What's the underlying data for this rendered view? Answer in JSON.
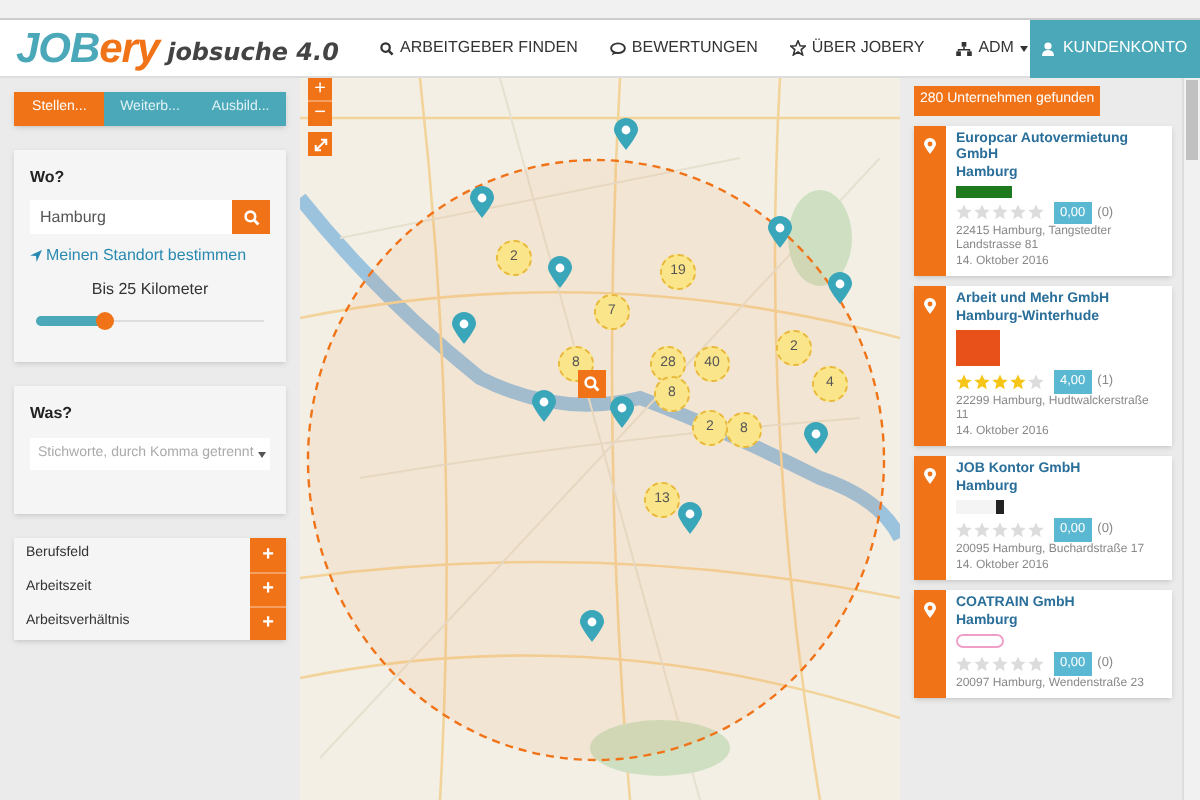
{
  "header": {
    "logo": {
      "part_1": "JOB",
      "part_2": "ery"
    },
    "tagline": "jobsuche 4.0",
    "nav": [
      {
        "kind": "search",
        "label": "ARBEITGEBER FINDEN"
      },
      {
        "kind": "reviews",
        "label": "BEWERTUNGEN"
      },
      {
        "kind": "star",
        "label": "ÜBER JOBERY"
      },
      {
        "kind": "menu",
        "label": "ADM"
      }
    ],
    "account_button": "KUNDENKONTO"
  },
  "sidebar": {
    "tabs": [
      {
        "label": "Stellen...",
        "selected": true
      },
      {
        "label": "Weiterb...",
        "selected": false
      },
      {
        "label": "Ausbild...",
        "selected": false
      }
    ],
    "where": {
      "title": "Wo?",
      "value": "Hamburg",
      "location_link": "Meinen Standort bestimmen",
      "radius_label": "Bis 25 Kilometer",
      "radius": {
        "level": 0.3
      }
    },
    "what": {
      "title": "Was?",
      "placeholder": "Stichworte, durch Komma getrennt"
    },
    "filters": [
      {
        "label": "Berufsfeld",
        "button": "+"
      },
      {
        "label": "Arbeitszeit",
        "button": "+"
      },
      {
        "label": "Arbeitsverhältnis",
        "button": "+"
      }
    ]
  },
  "map": {
    "zoom_in": "+",
    "zoom_out": "−",
    "clusters": [
      {
        "count": "2"
      },
      {
        "count": "19"
      },
      {
        "count": "7"
      },
      {
        "count": "2"
      },
      {
        "count": "8"
      },
      {
        "count": "28"
      },
      {
        "count": "40"
      },
      {
        "count": "4"
      },
      {
        "count": "8"
      },
      {
        "count": "2"
      },
      {
        "count": "8"
      },
      {
        "count": "13"
      }
    ]
  },
  "results": {
    "count_badge": "280 Unternehmen gefunden",
    "items": [
      {
        "name": "Europcar Autovermietung GmbH",
        "city": "Hamburg",
        "stars": 0,
        "rating": "0,00",
        "reviews": "(0)",
        "address": "22415 Hamburg, Tangstedter Landstrasse 81",
        "date": "14. Oktober 2016"
      },
      {
        "name": "Arbeit und Mehr GmbH",
        "city": "Hamburg-Winterhude",
        "stars": 4,
        "rating": "4,00",
        "reviews": "(1)",
        "address": "22299 Hamburg, Hudtwalckerstraße 11",
        "date": "14. Oktober 2016"
      },
      {
        "name": "JOB Kontor GmbH",
        "city": "Hamburg",
        "stars": 0,
        "rating": "0,00",
        "reviews": "(0)",
        "address": "20095 Hamburg, Buchardstraße 17",
        "date": "14. Oktober 2016"
      },
      {
        "name": "COATRAIN GmbH",
        "city": "Hamburg",
        "stars": 0,
        "rating": "0,00",
        "reviews": "(0)",
        "address": "20097 Hamburg, Wendenstraße 23"
      }
    ]
  }
}
